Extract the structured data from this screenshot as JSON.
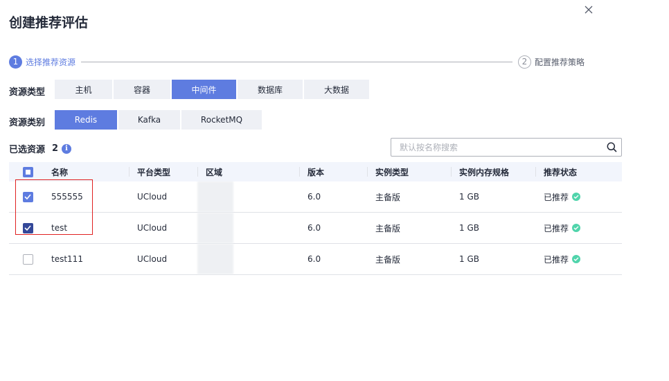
{
  "dialog": {
    "title": "创建推荐评估",
    "close_icon": "close-icon"
  },
  "steps": [
    {
      "number": "1",
      "label": "选择推荐资源",
      "state": "active"
    },
    {
      "number": "2",
      "label": "配置推荐策略",
      "state": "pending"
    }
  ],
  "resource_type": {
    "label": "资源类型",
    "tabs": [
      "主机",
      "容器",
      "中间件",
      "数据库",
      "大数据"
    ],
    "selected": "中间件"
  },
  "resource_category": {
    "label": "资源类别",
    "tabs": [
      "Redis",
      "Kafka",
      "RocketMQ"
    ],
    "selected": "Redis"
  },
  "selected_resources": {
    "label": "已选资源",
    "count": "2",
    "info_icon": "i"
  },
  "search": {
    "placeholder": "默认按名称搜索",
    "value": ""
  },
  "table": {
    "columns": [
      "名称",
      "平台类型",
      "区域",
      "版本",
      "实例类型",
      "实例内存规格",
      "推荐状态"
    ],
    "rows": [
      {
        "name": "555555",
        "platform": "UCloud",
        "region": "",
        "version": "6.0",
        "instance_type": "主备版",
        "memory": "1 GB",
        "status": "已推荐",
        "checked": true
      },
      {
        "name": "test",
        "platform": "UCloud",
        "region": "",
        "version": "6.0",
        "instance_type": "主备版",
        "memory": "1 GB",
        "status": "已推荐",
        "checked": true
      },
      {
        "name": "test111",
        "platform": "UCloud",
        "region": "",
        "version": "6.0",
        "instance_type": "主备版",
        "memory": "1 GB",
        "status": "已推荐",
        "checked": false
      }
    ]
  },
  "colors": {
    "primary": "#5e7ce0",
    "success": "#50d4ab",
    "highlight": "#e02020"
  }
}
